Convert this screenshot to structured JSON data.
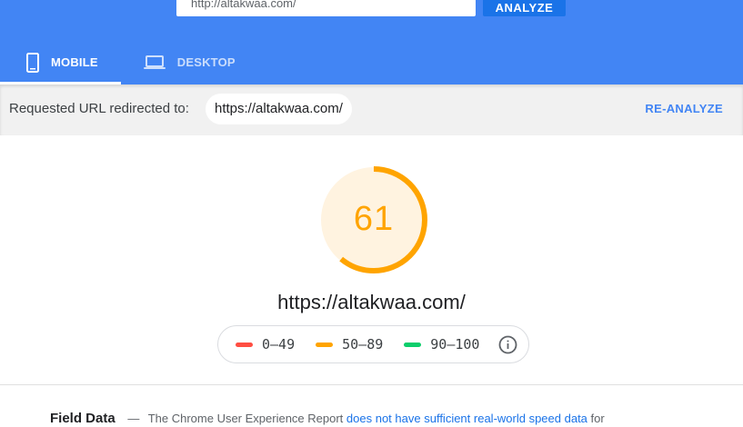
{
  "header": {
    "url_value": "http://altakwaa.com/",
    "analyze_label": "ANALYZE"
  },
  "tabs": [
    {
      "label": "MOBILE",
      "icon": "smartphone-icon",
      "active": true
    },
    {
      "label": "DESKTOP",
      "icon": "laptop-icon",
      "active": false
    }
  ],
  "redirect": {
    "label": "Requested URL redirected to:",
    "url": "https://altakwaa.com/",
    "reanalyze_label": "RE-ANALYZE"
  },
  "score": {
    "value": "61",
    "fraction": 0.61,
    "color": "#ffa400",
    "fill": "#fff3e0",
    "url": "https://altakwaa.com/"
  },
  "legend": [
    {
      "label": "0–49",
      "color": "#ff4e42"
    },
    {
      "label": "50–89",
      "color": "#ffa400"
    },
    {
      "label": "90–100",
      "color": "#0cce6b"
    }
  ],
  "field_data": {
    "title": "Field Data",
    "dash": "—",
    "text": "The Chrome User Experience Report",
    "link": "does not have sufficient real-world speed data",
    "tail": "for"
  },
  "colors": {
    "brand": "#4285f4",
    "link": "#1a73e8"
  }
}
